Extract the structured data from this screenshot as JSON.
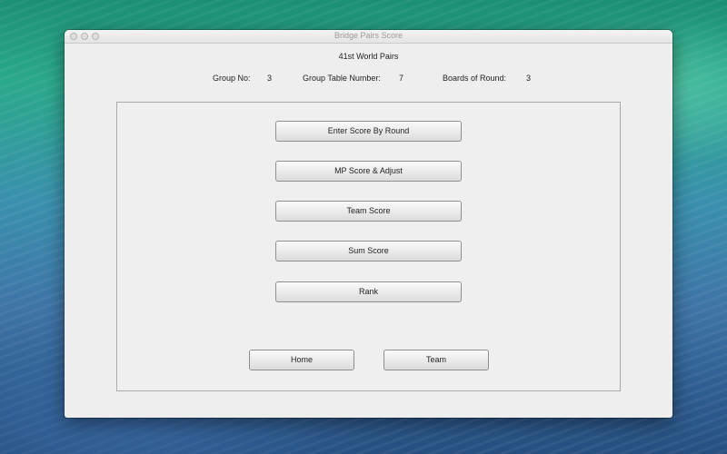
{
  "window": {
    "title": "Bridge Pairs Score"
  },
  "header": {
    "event_name": "41st World Pairs",
    "group_no_label": "Group No:",
    "group_no_value": "3",
    "group_table_label": "Group Table Number:",
    "group_table_value": "7",
    "boards_label": "Boards of Round:",
    "boards_value": "3"
  },
  "menu": {
    "enter_score_by_round": "Enter Score By Round",
    "mp_score_adjust": "MP Score & Adjust",
    "team_score": "Team Score",
    "sum_score": "Sum Score",
    "rank": "Rank"
  },
  "nav": {
    "home": "Home",
    "team": "Team"
  }
}
